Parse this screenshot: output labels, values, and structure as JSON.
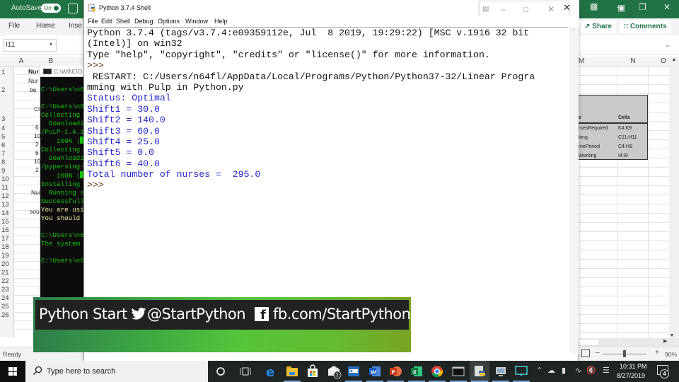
{
  "excel": {
    "autosave_label": "AutoSave",
    "autosave_state": "On",
    "ribbon_tabs": [
      "File",
      "Home",
      "Inse"
    ],
    "share_label": "Share",
    "comments_label": "Comments",
    "name_box": "I11",
    "column_headers_left": [
      "A",
      "B"
    ],
    "column_headers_right": [
      "M",
      "N",
      "O"
    ],
    "row_numbers": [
      "1",
      "2",
      "3",
      "4",
      "5",
      "6",
      "7",
      "8",
      "9",
      "10",
      "11",
      "12",
      "13",
      "14",
      "15",
      "16",
      "17",
      "18",
      "19",
      "20",
      "21",
      "22",
      "23",
      "24",
      "25",
      "26"
    ],
    "col_b_cells": [
      {
        "row": "1",
        "text": "Nur",
        "bold": true
      },
      {
        "row": "2a",
        "text": "Nur"
      },
      {
        "row": "2b",
        "text": "be"
      },
      {
        "row": "3a",
        "text": "Cl"
      },
      {
        "row": "4",
        "text": "6"
      },
      {
        "row": "5",
        "text": "10"
      },
      {
        "row": "6",
        "text": "2"
      },
      {
        "row": "7",
        "text": "6"
      },
      {
        "row": "8",
        "text": "10"
      },
      {
        "row": "9",
        "text": "2"
      },
      {
        "row": "11",
        "text": "Nur"
      },
      {
        "row": "13",
        "text": "sou"
      }
    ],
    "named_ranges_table": {
      "headers": [
        "e",
        "Cells"
      ],
      "rows": [
        [
          "rsesRequired",
          "K4:K9"
        ],
        [
          "king",
          "C11:H11"
        ],
        [
          "mePeriod",
          "C4:H9"
        ],
        [
          "Working",
          "I4:I9"
        ]
      ]
    },
    "status": "Ready",
    "zoom_level": "90%",
    "zoom_fraction": 0.5
  },
  "cmd": {
    "title": "C:\\WINDO",
    "lines": [
      {
        "text": "",
        "color": "green"
      },
      {
        "text": "C:\\Users\\n6",
        "color": "green"
      },
      {
        "text": "",
        "color": "green"
      },
      {
        "text": "C:\\Users\\n6",
        "color": "green"
      },
      {
        "text": "Collecting ",
        "color": "green"
      },
      {
        "text": "  Downloadi",
        "color": "green"
      },
      {
        "text": "/PuLP-1.6.1",
        "color": "green"
      },
      {
        "text": "    100% |",
        "color": "green",
        "bar": true
      },
      {
        "text": "Collecting ",
        "color": "green"
      },
      {
        "text": "  Downloadi",
        "color": "green"
      },
      {
        "text": "/pyparsing-",
        "color": "green"
      },
      {
        "text": "    100% |",
        "color": "green",
        "bar": true
      },
      {
        "text": "Installing ",
        "color": "green"
      },
      {
        "text": "  Running s",
        "color": "green"
      },
      {
        "text": "Successfull",
        "color": "green"
      },
      {
        "text": "You are usi",
        "color": "yellow"
      },
      {
        "text": "You should ",
        "color": "yellow"
      },
      {
        "text": "",
        "color": "green"
      },
      {
        "text": "C:\\Users\\n6",
        "color": "green"
      },
      {
        "text": "The system ",
        "color": "green"
      },
      {
        "text": "",
        "color": "green"
      },
      {
        "text": "C:\\Users\\n6",
        "color": "green"
      }
    ]
  },
  "idle": {
    "title": "Python 3.7.4 Shell",
    "menu": [
      "File",
      "Edit",
      "Shell",
      "Debug",
      "Options",
      "Window",
      "Help"
    ],
    "lines": [
      {
        "text": "Python 3.7.4 (tags/v3.7.4:e09359112e, Jul  8 2019, 19:29:22) [MSC v.1916 32 bit",
        "style": "black"
      },
      {
        "text": "(Intel)] on win32",
        "style": "black"
      },
      {
        "text": "Type \"help\", \"copyright\", \"credits\" or \"license()\" for more information.",
        "style": "black"
      },
      {
        "text": ">>> ",
        "style": "prompt"
      },
      {
        "text": " RESTART: C:/Users/n64fl/AppData/Local/Programs/Python/Python37-32/Linear Progra",
        "style": "black"
      },
      {
        "text": "mming with Pulp in Python.py",
        "style": "black"
      },
      {
        "text": "Status: Optimal",
        "style": "blue"
      },
      {
        "text": "Shift1 = 30.0",
        "style": "blue"
      },
      {
        "text": "Shift2 = 140.0",
        "style": "blue"
      },
      {
        "text": "Shift3 = 60.0",
        "style": "blue"
      },
      {
        "text": "Shift4 = 25.0",
        "style": "blue"
      },
      {
        "text": "Shift5 = 0.0",
        "style": "blue"
      },
      {
        "text": "Shift6 = 40.0",
        "style": "blue"
      },
      {
        "text": "Total number of nurses =  295.0",
        "style": "blue"
      },
      {
        "text": ">>> ",
        "style": "prompt"
      }
    ]
  },
  "banner": {
    "brand": "Python Start",
    "twitter_handle": "@StartPython",
    "facebook_url": "fb.com/StartPython",
    "twitter_icon": "twitter-bird-icon",
    "facebook_icon": "facebook-f-icon"
  },
  "taskbar": {
    "search_placeholder": "Type here to search",
    "apps": [
      "cortana",
      "task-view",
      "edge",
      "file-explorer",
      "store",
      "mail",
      "remote-desktop",
      "word",
      "powerpoint",
      "excel",
      "chrome",
      "command-prompt",
      "idle",
      "network-monitor",
      "connect"
    ],
    "mail_badge": "7",
    "time": "10:31 PM",
    "date": "8/27/2019",
    "notification_count": "4"
  }
}
